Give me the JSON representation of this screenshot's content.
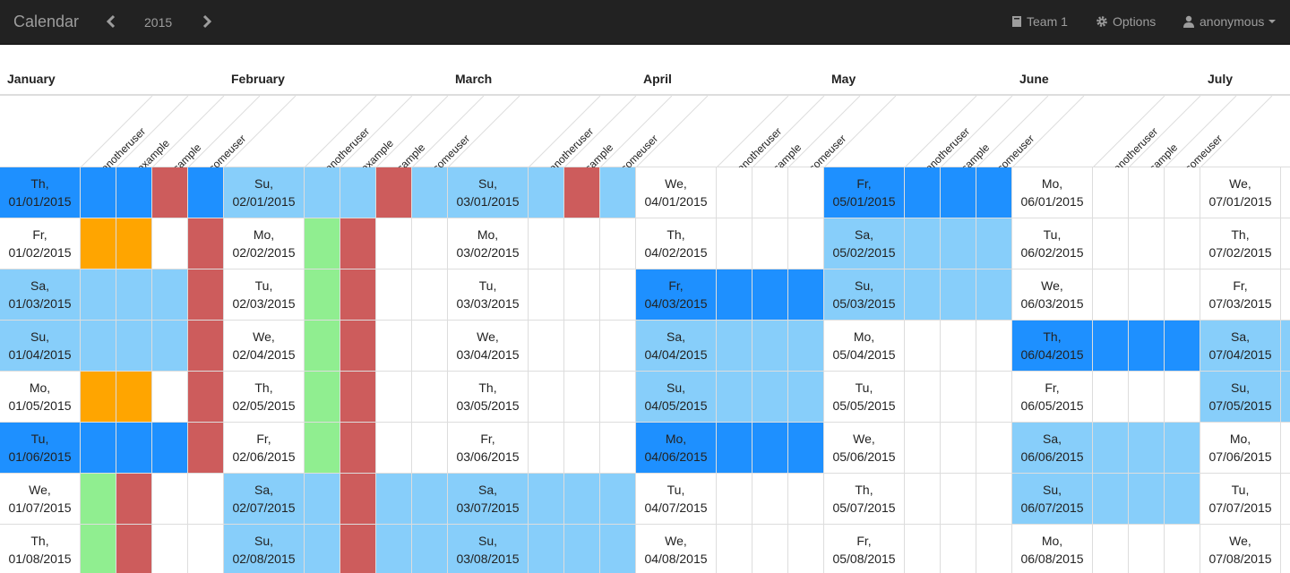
{
  "navbar": {
    "brand": "Calendar",
    "year": "2015",
    "team_label": "Team 1",
    "options_label": "Options",
    "user_label": "anonymous"
  },
  "colors": {
    "navbar_bg": "#222222",
    "dark_blue": "#1e90ff",
    "light_blue": "#87cefa",
    "red": "#cd5c5c",
    "green": "#90ee90",
    "orange": "#ffa500",
    "grid_line": "#dddddd"
  },
  "icons": {
    "prev": "chevron-left-icon",
    "next": "chevron-right-icon",
    "team": "book-icon",
    "options": "gear-icon",
    "user": "user-icon",
    "caret": "caret-down-icon"
  },
  "months": [
    {
      "name": "January",
      "users": [
        "anotheruser",
        "example",
        "sample",
        "someuser"
      ],
      "days": [
        [
          "Th,",
          "01/01/2015"
        ],
        [
          "Fr,",
          "01/02/2015"
        ],
        [
          "Sa,",
          "01/03/2015"
        ],
        [
          "Su,",
          "01/04/2015"
        ],
        [
          "Mo,",
          "01/05/2015"
        ],
        [
          "Tu,",
          "01/06/2015"
        ],
        [
          "We,",
          "01/07/2015"
        ],
        [
          "Th,",
          "01/08/2015"
        ]
      ],
      "colors": [
        [
          "D",
          "D",
          "D",
          "R",
          "D"
        ],
        [
          "W",
          "O",
          "O",
          "W",
          "R"
        ],
        [
          "L",
          "L",
          "L",
          "L",
          "R"
        ],
        [
          "L",
          "L",
          "L",
          "L",
          "R"
        ],
        [
          "W",
          "O",
          "O",
          "W",
          "R"
        ],
        [
          "D",
          "D",
          "D",
          "D",
          "R"
        ],
        [
          "W",
          "G",
          "R",
          "W",
          "W"
        ],
        [
          "W",
          "G",
          "R",
          "W",
          "W"
        ]
      ]
    },
    {
      "name": "February",
      "users": [
        "anotheruser",
        "example",
        "sample",
        "someuser"
      ],
      "days": [
        [
          "Su,",
          "02/01/2015"
        ],
        [
          "Mo,",
          "02/02/2015"
        ],
        [
          "Tu,",
          "02/03/2015"
        ],
        [
          "We,",
          "02/04/2015"
        ],
        [
          "Th,",
          "02/05/2015"
        ],
        [
          "Fr,",
          "02/06/2015"
        ],
        [
          "Sa,",
          "02/07/2015"
        ],
        [
          "Su,",
          "02/08/2015"
        ]
      ],
      "colors": [
        [
          "L",
          "L",
          "L",
          "R",
          "L"
        ],
        [
          "W",
          "G",
          "R",
          "W",
          "W"
        ],
        [
          "W",
          "G",
          "R",
          "W",
          "W"
        ],
        [
          "W",
          "G",
          "R",
          "W",
          "W"
        ],
        [
          "W",
          "G",
          "R",
          "W",
          "W"
        ],
        [
          "W",
          "G",
          "R",
          "W",
          "W"
        ],
        [
          "L",
          "L",
          "R",
          "L",
          "L"
        ],
        [
          "L",
          "L",
          "R",
          "L",
          "L"
        ]
      ]
    },
    {
      "name": "March",
      "users": [
        "anotheruser",
        "sample",
        "someuser"
      ],
      "days": [
        [
          "Su,",
          "03/01/2015"
        ],
        [
          "Mo,",
          "03/02/2015"
        ],
        [
          "Tu,",
          "03/03/2015"
        ],
        [
          "We,",
          "03/04/2015"
        ],
        [
          "Th,",
          "03/05/2015"
        ],
        [
          "Fr,",
          "03/06/2015"
        ],
        [
          "Sa,",
          "03/07/2015"
        ],
        [
          "Su,",
          "03/08/2015"
        ]
      ],
      "colors": [
        [
          "L",
          "L",
          "R",
          "L"
        ],
        [
          "W",
          "W",
          "W",
          "W"
        ],
        [
          "W",
          "W",
          "W",
          "W"
        ],
        [
          "W",
          "W",
          "W",
          "W"
        ],
        [
          "W",
          "W",
          "W",
          "W"
        ],
        [
          "W",
          "W",
          "W",
          "W"
        ],
        [
          "L",
          "L",
          "L",
          "L"
        ],
        [
          "L",
          "L",
          "L",
          "L"
        ]
      ]
    },
    {
      "name": "April",
      "users": [
        "anotheruser",
        "sample",
        "someuser"
      ],
      "days": [
        [
          "We,",
          "04/01/2015"
        ],
        [
          "Th,",
          "04/02/2015"
        ],
        [
          "Fr,",
          "04/03/2015"
        ],
        [
          "Sa,",
          "04/04/2015"
        ],
        [
          "Su,",
          "04/05/2015"
        ],
        [
          "Mo,",
          "04/06/2015"
        ],
        [
          "Tu,",
          "04/07/2015"
        ],
        [
          "We,",
          "04/08/2015"
        ]
      ],
      "colors": [
        [
          "W",
          "W",
          "W",
          "W"
        ],
        [
          "W",
          "W",
          "W",
          "W"
        ],
        [
          "D",
          "D",
          "D",
          "D"
        ],
        [
          "L",
          "L",
          "L",
          "L"
        ],
        [
          "L",
          "L",
          "L",
          "L"
        ],
        [
          "D",
          "D",
          "D",
          "D"
        ],
        [
          "W",
          "W",
          "W",
          "W"
        ],
        [
          "W",
          "W",
          "W",
          "W"
        ]
      ]
    },
    {
      "name": "May",
      "users": [
        "anotheruser",
        "sample",
        "someuser"
      ],
      "days": [
        [
          "Fr,",
          "05/01/2015"
        ],
        [
          "Sa,",
          "05/02/2015"
        ],
        [
          "Su,",
          "05/03/2015"
        ],
        [
          "Mo,",
          "05/04/2015"
        ],
        [
          "Tu,",
          "05/05/2015"
        ],
        [
          "We,",
          "05/06/2015"
        ],
        [
          "Th,",
          "05/07/2015"
        ],
        [
          "Fr,",
          "05/08/2015"
        ]
      ],
      "colors": [
        [
          "D",
          "D",
          "D",
          "D"
        ],
        [
          "L",
          "L",
          "L",
          "L"
        ],
        [
          "L",
          "L",
          "L",
          "L"
        ],
        [
          "W",
          "W",
          "W",
          "W"
        ],
        [
          "W",
          "W",
          "W",
          "W"
        ],
        [
          "W",
          "W",
          "W",
          "W"
        ],
        [
          "W",
          "W",
          "W",
          "W"
        ],
        [
          "W",
          "W",
          "W",
          "W"
        ]
      ]
    },
    {
      "name": "June",
      "users": [
        "anotheruser",
        "sample",
        "someuser"
      ],
      "days": [
        [
          "Mo,",
          "06/01/2015"
        ],
        [
          "Tu,",
          "06/02/2015"
        ],
        [
          "We,",
          "06/03/2015"
        ],
        [
          "Th,",
          "06/04/2015"
        ],
        [
          "Fr,",
          "06/05/2015"
        ],
        [
          "Sa,",
          "06/06/2015"
        ],
        [
          "Su,",
          "06/07/2015"
        ],
        [
          "Mo,",
          "06/08/2015"
        ]
      ],
      "colors": [
        [
          "W",
          "W",
          "W",
          "W"
        ],
        [
          "W",
          "W",
          "W",
          "W"
        ],
        [
          "W",
          "W",
          "W",
          "W"
        ],
        [
          "D",
          "D",
          "D",
          "D"
        ],
        [
          "W",
          "W",
          "W",
          "W"
        ],
        [
          "L",
          "L",
          "L",
          "L"
        ],
        [
          "L",
          "L",
          "L",
          "L"
        ],
        [
          "W",
          "W",
          "W",
          "W"
        ]
      ]
    },
    {
      "name": "July",
      "users": [],
      "days": [
        [
          "We,",
          "07/01/2015"
        ],
        [
          "Th,",
          "07/02/2015"
        ],
        [
          "Fr,",
          "07/03/2015"
        ],
        [
          "Sa,",
          "07/04/2015"
        ],
        [
          "Su,",
          "07/05/2015"
        ],
        [
          "Mo,",
          "07/06/2015"
        ],
        [
          "Tu,",
          "07/07/2015"
        ],
        [
          "We,",
          "07/08/2015"
        ]
      ],
      "colors": [
        [
          "W",
          "W"
        ],
        [
          "W",
          "W"
        ],
        [
          "W",
          "W"
        ],
        [
          "L",
          "L"
        ],
        [
          "L",
          "L"
        ],
        [
          "W",
          "W"
        ],
        [
          "W",
          "W"
        ],
        [
          "W",
          "W"
        ]
      ]
    }
  ]
}
